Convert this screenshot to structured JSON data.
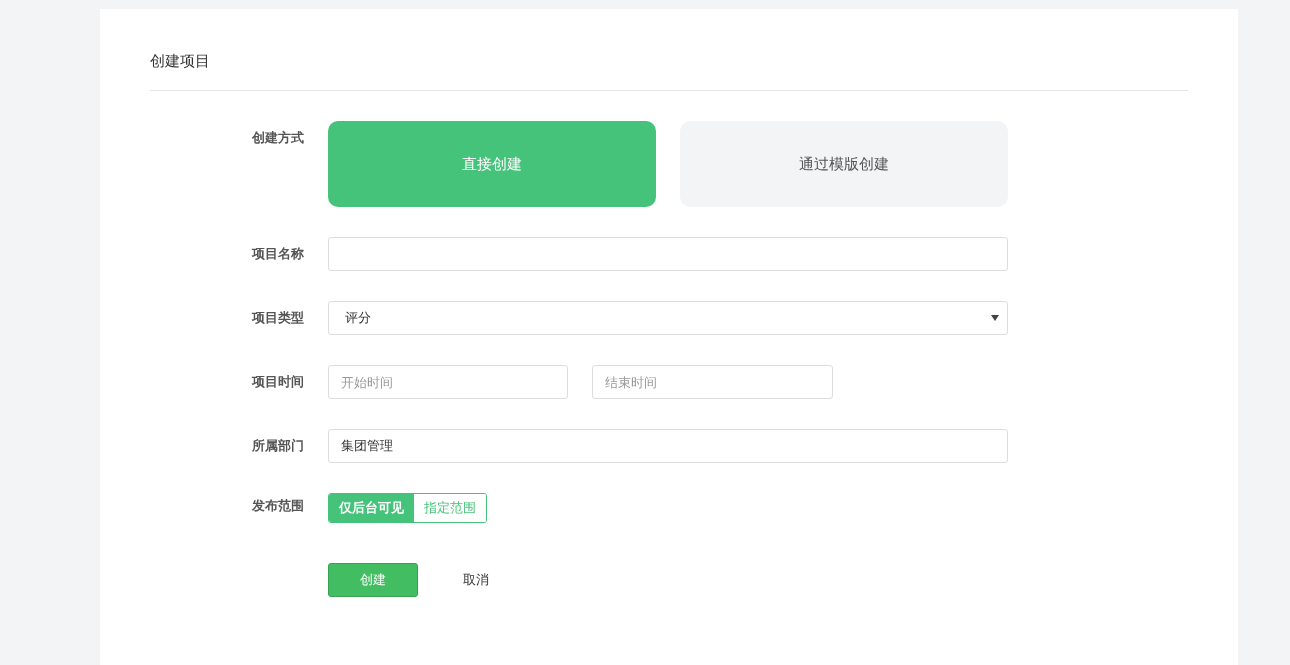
{
  "title": "创建项目",
  "rows": [
    {
      "kind": "cards",
      "label": "创建方式",
      "options": [
        {
          "label": "直接创建",
          "selected": true
        },
        {
          "label": "通过模版创建",
          "selected": false
        }
      ]
    },
    {
      "kind": "text",
      "label": "项目名称"
    },
    {
      "kind": "select",
      "label": "项目类型",
      "value": "评分"
    },
    {
      "kind": "daterange",
      "label": "项目时间",
      "start_placeholder": "开始时间",
      "end_placeholder": "结束时间"
    },
    {
      "kind": "text",
      "label": "所属部门",
      "value": "集团管理"
    },
    {
      "kind": "segmented",
      "label": "发布范围",
      "options": [
        {
          "label": "仅后台可见",
          "selected": true
        },
        {
          "label": "指定范围",
          "selected": false
        }
      ]
    }
  ],
  "actions": {
    "submit": "创建",
    "cancel": "取消"
  }
}
